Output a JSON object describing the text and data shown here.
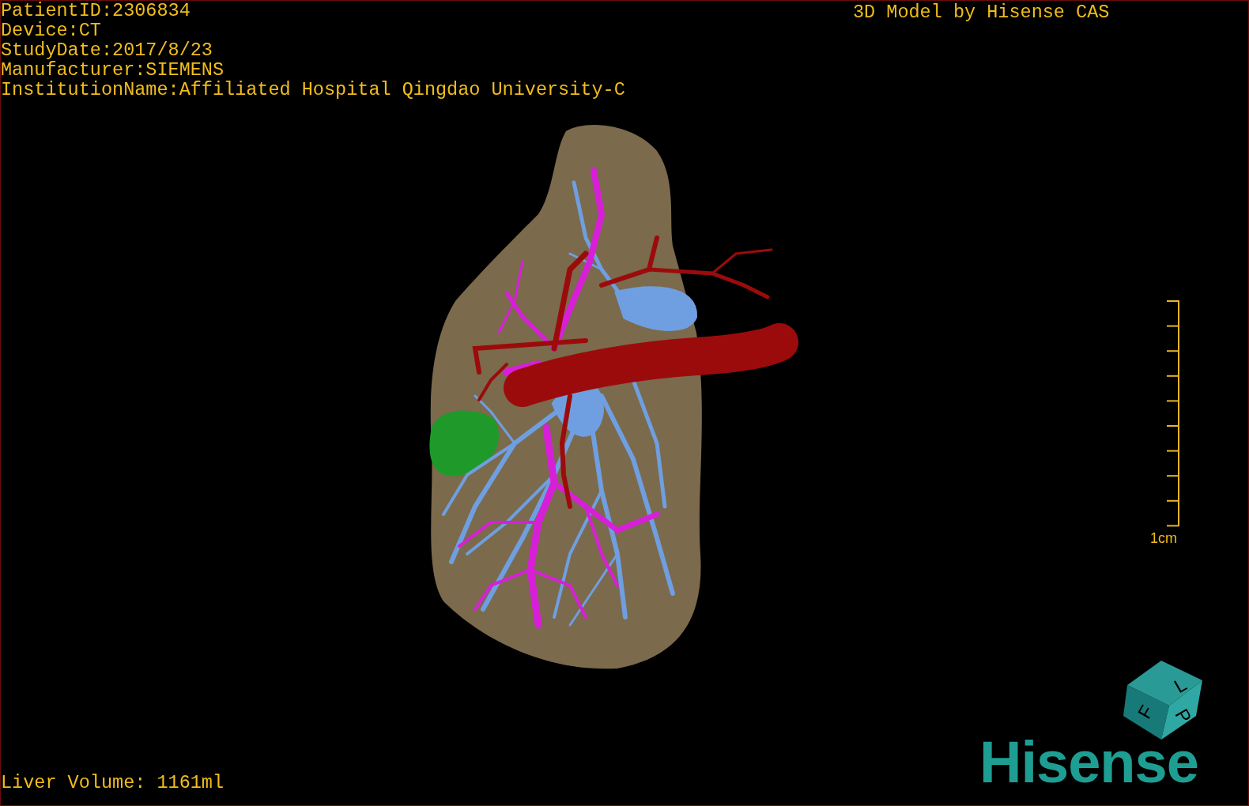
{
  "info_lines": [
    "PatientID:2306834",
    "Device:CT",
    "StudyDate:2017/8/23",
    "Manufacturer:SIEMENS",
    "InstitutionName:Affiliated Hospital Qingdao University-C"
  ],
  "caption": "3D Model by Hisense CAS",
  "scale_bar": {
    "label": "1cm"
  },
  "orientation_cube": {
    "labels": [
      "F",
      "L",
      "P"
    ]
  },
  "logo": "Hisense",
  "liver_volume": "Liver Volume: 1161ml"
}
